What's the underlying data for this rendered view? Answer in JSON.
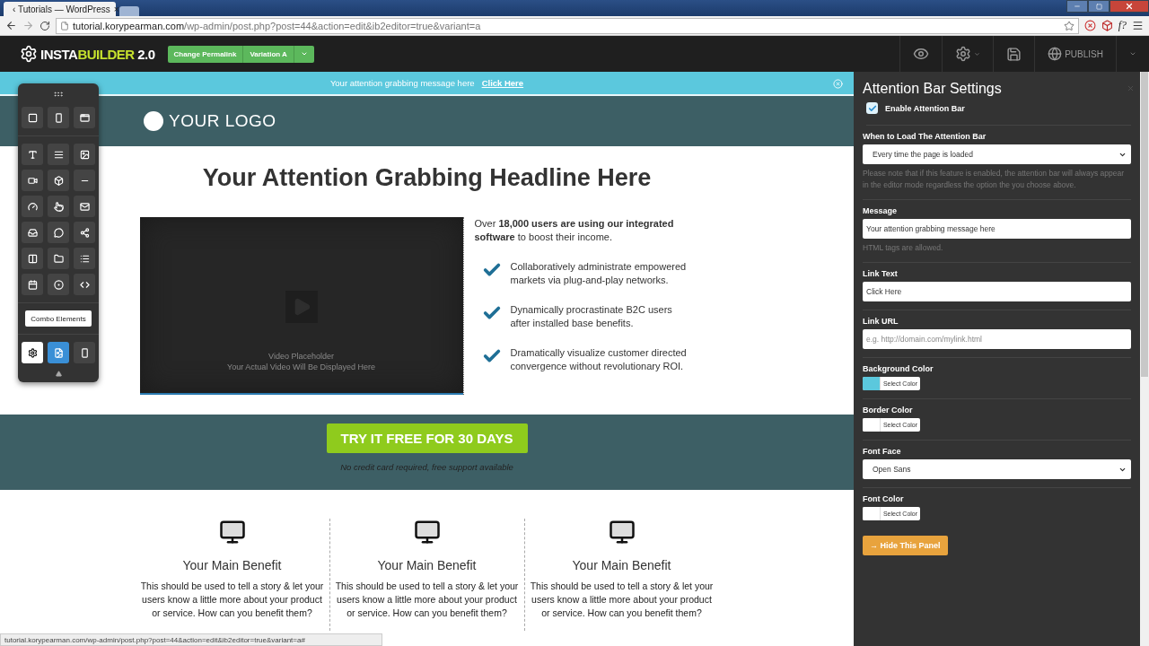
{
  "browser": {
    "tab_title": "‹ Tutorials — WordPress",
    "tab_close": "×",
    "url_host": "tutorial.korypearman.com",
    "url_path": "/wp-admin/post.php?post=44&action=edit&ib2editor=true&variant=a",
    "extension_text": "f?",
    "status_url": "tutorial.korypearman.com/wp-admin/post.php?post=44&action=edit&ib2editor=true&variant=a#"
  },
  "app_bar": {
    "logo_left": "INSTA",
    "logo_right": "BUILDER",
    "logo_version": "2.0",
    "permalink_button": "Change Permalink",
    "variation_button": "Variation A",
    "publish": "PUBLISH"
  },
  "attention_bar": {
    "message": "Your attention grabbing message here",
    "link": "Click Here"
  },
  "page": {
    "logo": "YOUR LOGO",
    "headline": "Your Attention Grabbing Headline Here",
    "video_title": "Video Placeholder",
    "video_subtitle": "Your Actual Video Will Be Displayed Here",
    "intro": "Over **18,000 users are using our integrated software** to boost their income.",
    "bullets": [
      "Collaboratively administrate empowered markets via plug-and-play networks.",
      "Dynamically procrastinate B2C users after installed base benefits.",
      "Dramatically visualize customer directed convergence without revolutionary ROI."
    ],
    "cta": "TRY IT FREE FOR 30 DAYS",
    "cta_note": "No credit card required, free support available",
    "benefits": [
      {
        "title": "Your Main Benefit",
        "text": "This should be used to tell a story & let your users know a little more about your product or service. How can you benefit them?"
      },
      {
        "title": "Your Main Benefit",
        "text": "This should be used to tell a story & let your users know a little more about your product or service. How can you benefit them?"
      },
      {
        "title": "Your Main Benefit",
        "text": "This should be used to tell a story & let your users know a little more about your product or service. How can you benefit them?"
      }
    ]
  },
  "toolbar": {
    "combo": "Combo Elements",
    "modes": [
      {
        "kind": "light"
      },
      {
        "kind": "primary"
      },
      {
        "kind": "dark"
      }
    ]
  },
  "panel": {
    "title": "Attention Bar Settings",
    "enable": {
      "label": "Enable Attention Bar",
      "checked": true
    },
    "fields": [
      {
        "kind": "select",
        "label": "When to Load The Attention Bar",
        "value": "Every time the page is loaded",
        "note": "Please note that if this feature is enabled, the attention bar will always appear in the editor mode regardless the option the you choose above."
      },
      {
        "kind": "text",
        "label": "Message",
        "value": "Your attention grabbing message here",
        "note": "HTML tags are allowed."
      },
      {
        "kind": "text",
        "label": "Link Text",
        "value": "Click Here"
      },
      {
        "kind": "text",
        "label": "Link URL",
        "placeholder": "e.g. http://domain.com/mylink.html"
      },
      {
        "kind": "color",
        "label": "Background Color",
        "button": "Select Color",
        "color": "#5bc8dd"
      },
      {
        "kind": "color",
        "label": "Border Color",
        "button": "Select Color",
        "color": "#ffffff"
      },
      {
        "kind": "select",
        "label": "Font Face",
        "value": "Open Sans"
      },
      {
        "kind": "color",
        "label": "Font Color",
        "button": "Select Color",
        "color": "#ffffff"
      }
    ],
    "hide_button": "→ Hide This Panel"
  }
}
